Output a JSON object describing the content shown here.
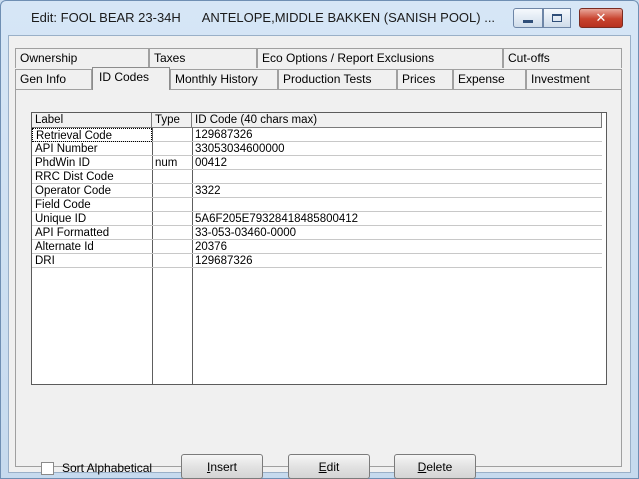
{
  "window": {
    "title": "Edit: FOOL BEAR 23-34H      ANTELOPE,MIDDLE BAKKEN (SANISH POOL) ...",
    "controls": {
      "minimize_icon": "minimize-icon",
      "maximize_icon": "maximize-icon",
      "close_glyph": "✕"
    }
  },
  "tabs": {
    "row_top": [
      "Ownership",
      "Taxes",
      "Eco Options / Report Exclusions",
      "Cut-offs"
    ],
    "row_bottom": [
      "Gen Info",
      "ID Codes",
      "Monthly History",
      "Production Tests",
      "Prices",
      "Expense",
      "Investment"
    ],
    "active": "ID Codes"
  },
  "grid": {
    "headers": [
      "Label",
      "Type",
      "ID Code (40 chars max)"
    ],
    "rows": [
      {
        "label": "Retrieval Code",
        "type": "",
        "code": "129687326"
      },
      {
        "label": "API Number",
        "type": "",
        "code": "33053034600000"
      },
      {
        "label": "PhdWin ID",
        "type": "num",
        "code": "00412"
      },
      {
        "label": "RRC Dist Code",
        "type": "",
        "code": ""
      },
      {
        "label": "Operator Code",
        "type": "",
        "code": "3322"
      },
      {
        "label": "Field Code",
        "type": "",
        "code": ""
      },
      {
        "label": "Unique ID",
        "type": "",
        "code": "5A6F205E79328418485800412"
      },
      {
        "label": "API Formatted",
        "type": "",
        "code": "33-053-03460-0000"
      },
      {
        "label": "Alternate Id",
        "type": "",
        "code": "20376"
      },
      {
        "label": "DRI",
        "type": "",
        "code": "129687326"
      }
    ]
  },
  "options": {
    "sort_label": "Sort Alphabetical",
    "sort_checked": false
  },
  "buttons": {
    "insert_first": "I",
    "insert_rest": "nsert",
    "edit_first": "E",
    "edit_rest": "dit",
    "delete_first": "D",
    "delete_rest": "elete"
  }
}
